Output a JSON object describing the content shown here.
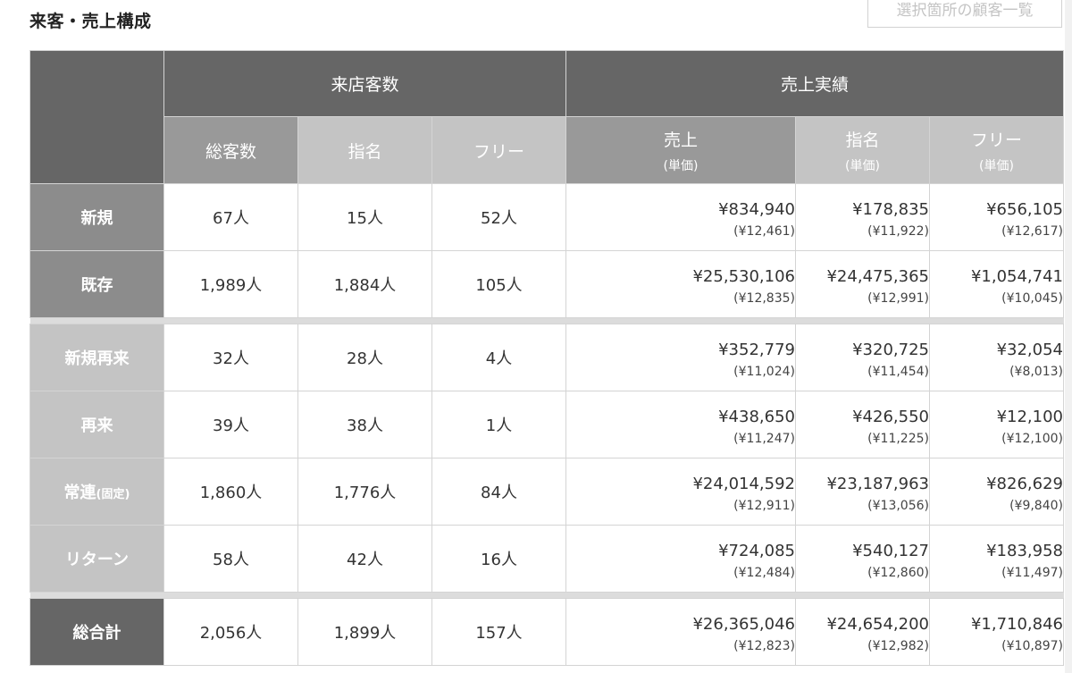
{
  "section_title": "来客・売上構成",
  "list_button_label": "選択箇所の顧客一覧",
  "group_headers": {
    "visitors": "来店客数",
    "sales": "売上実績"
  },
  "sub_headers": {
    "total_customers": "総客数",
    "designated": "指名",
    "free": "フリー",
    "sales": "売上",
    "sales_designated": "指名",
    "sales_free": "フリー",
    "unit_price": "(単価)"
  },
  "rows_top": [
    {
      "label": "新規",
      "total": "67人",
      "designated": "15人",
      "free": "52人",
      "sales": "¥834,940",
      "sales_unit": "(¥12,461)",
      "sales_designated": "¥178,835",
      "sales_designated_unit": "(¥11,922)",
      "sales_free": "¥656,105",
      "sales_free_unit": "(¥12,617)"
    },
    {
      "label": "既存",
      "total": "1,989人",
      "designated": "1,884人",
      "free": "105人",
      "sales": "¥25,530,106",
      "sales_unit": "(¥12,835)",
      "sales_designated": "¥24,475,365",
      "sales_designated_unit": "(¥12,991)",
      "sales_free": "¥1,054,741",
      "sales_free_unit": "(¥10,045)"
    }
  ],
  "rows_detail": [
    {
      "label": "新規再来",
      "total": "32人",
      "designated": "28人",
      "free": "4人",
      "sales": "¥352,779",
      "sales_unit": "(¥11,024)",
      "sales_designated": "¥320,725",
      "sales_designated_unit": "(¥11,454)",
      "sales_free": "¥32,054",
      "sales_free_unit": "(¥8,013)"
    },
    {
      "label": "再来",
      "total": "39人",
      "designated": "38人",
      "free": "1人",
      "sales": "¥438,650",
      "sales_unit": "(¥11,247)",
      "sales_designated": "¥426,550",
      "sales_designated_unit": "(¥11,225)",
      "sales_free": "¥12,100",
      "sales_free_unit": "(¥12,100)"
    },
    {
      "label": "常連",
      "label_tag": "(固定)",
      "total": "1,860人",
      "designated": "1,776人",
      "free": "84人",
      "sales": "¥24,014,592",
      "sales_unit": "(¥12,911)",
      "sales_designated": "¥23,187,963",
      "sales_designated_unit": "(¥13,056)",
      "sales_free": "¥826,629",
      "sales_free_unit": "(¥9,840)"
    },
    {
      "label": "リターン",
      "total": "58人",
      "designated": "42人",
      "free": "16人",
      "sales": "¥724,085",
      "sales_unit": "(¥12,484)",
      "sales_designated": "¥540,127",
      "sales_designated_unit": "(¥12,860)",
      "sales_free": "¥183,958",
      "sales_free_unit": "(¥11,497)"
    }
  ],
  "row_total": {
    "label": "総合計",
    "total": "2,056人",
    "designated": "1,899人",
    "free": "157人",
    "sales": "¥26,365,046",
    "sales_unit": "(¥12,823)",
    "sales_designated": "¥24,654,200",
    "sales_designated_unit": "(¥12,982)",
    "sales_free": "¥1,710,846",
    "sales_free_unit": "(¥10,897)"
  },
  "colors": {
    "header_dark": "#666666",
    "header_mid": "#999999",
    "header_light": "#c4c4c4",
    "row_header_dark": "#8c8c8c"
  }
}
